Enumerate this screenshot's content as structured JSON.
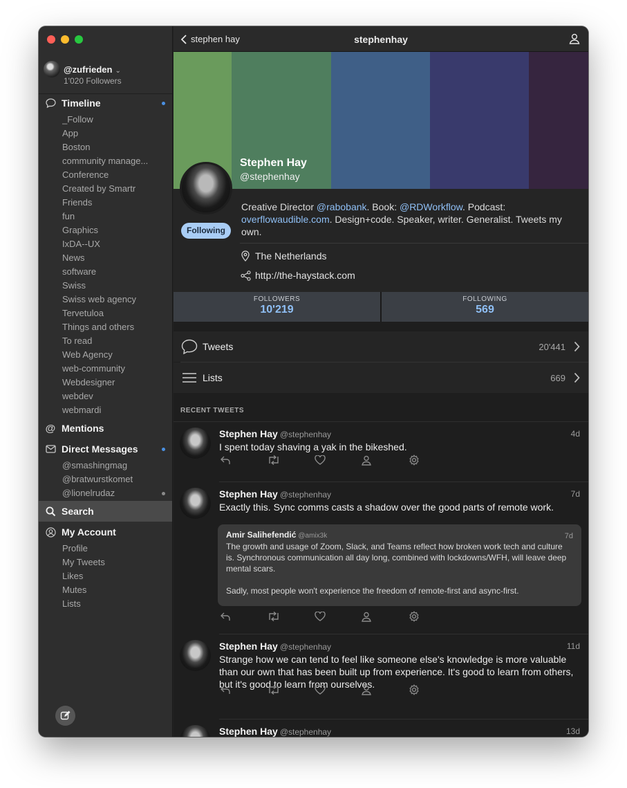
{
  "sidebar": {
    "account": {
      "handle": "@zufrieden",
      "followers": "1'020 Followers"
    },
    "timeline": {
      "label": "Timeline",
      "lists": [
        "_Follow",
        "App",
        "Boston",
        "community manage...",
        "Conference",
        "Created by Smartr",
        "Friends",
        "fun",
        "Graphics",
        "IxDA--UX",
        "News",
        "software",
        "Swiss",
        "Swiss web agency",
        "Tervetuloa",
        "Things and others",
        "To read",
        "Web Agency",
        "web-community",
        "Webdesigner",
        "webdev",
        "webmardi"
      ]
    },
    "mentions": {
      "label": "Mentions"
    },
    "direct_messages": {
      "label": "Direct Messages",
      "items": [
        "@smashingmag",
        "@bratwurstkomet",
        "@lionelrudaz"
      ]
    },
    "search": {
      "label": "Search"
    },
    "my_account": {
      "label": "My Account",
      "items": [
        "Profile",
        "My Tweets",
        "Likes",
        "Mutes",
        "Lists"
      ]
    }
  },
  "titlebar": {
    "back_label": "stephen hay",
    "title": "stephenhay"
  },
  "profile": {
    "banner_colors": [
      "#6a9b5c",
      "#4f7e5e",
      "#3f5f87",
      "#393a6c",
      "#36253f"
    ],
    "name": "Stephen Hay",
    "screen_name": "@stephenhay",
    "follow_state": "Following",
    "bio": {
      "p1": "Creative Director ",
      "l1": "@rabobank",
      "p2": ". Book: ",
      "l2": "@RDWorkflow",
      "p3": ". Podcast: ",
      "l3": "overflowaudible.com",
      "p4": ". Design+code. Speaker, writer. Generalist. Tweets my own."
    },
    "location": "The Netherlands",
    "url": "http://the-haystack.com",
    "stats": {
      "followers_label": "FOLLOWERS",
      "followers": "10'219",
      "following_label": "FOLLOWING",
      "following": "569"
    },
    "tweets_row": {
      "label": "Tweets",
      "count": "20'441"
    },
    "lists_row": {
      "label": "Lists",
      "count": "669"
    },
    "recent_header": "RECENT TWEETS"
  },
  "tweets": [
    {
      "name": "Stephen Hay",
      "handle": "@stephenhay",
      "time": "4d",
      "text": "I spent today shaving a yak in the bikeshed."
    },
    {
      "name": "Stephen Hay",
      "handle": "@stephenhay",
      "time": "7d",
      "text": "Exactly this. Sync comms casts a shadow over the good parts of remote work.",
      "quote": {
        "name": "Amir Salihefendić",
        "handle": "@amix3k",
        "time": "7d",
        "text1": "The growth and usage of Zoom, Slack, and Teams reflect how broken work tech and culture is. Synchronous communication all day long, combined with lockdowns/WFH, will leave deep mental scars.",
        "text2": "Sadly, most people won't experience the freedom of remote-first and async-first."
      }
    },
    {
      "name": "Stephen Hay",
      "handle": "@stephenhay",
      "time": "11d",
      "text": "Strange how we can tend to feel like someone else's knowledge is more valuable than our own that has been built up from experience. It's good to learn from others, but it's good to learn from ourselves."
    },
    {
      "name": "Stephen Hay",
      "handle": "@stephenhay",
      "time": "13d",
      "text": ""
    }
  ]
}
